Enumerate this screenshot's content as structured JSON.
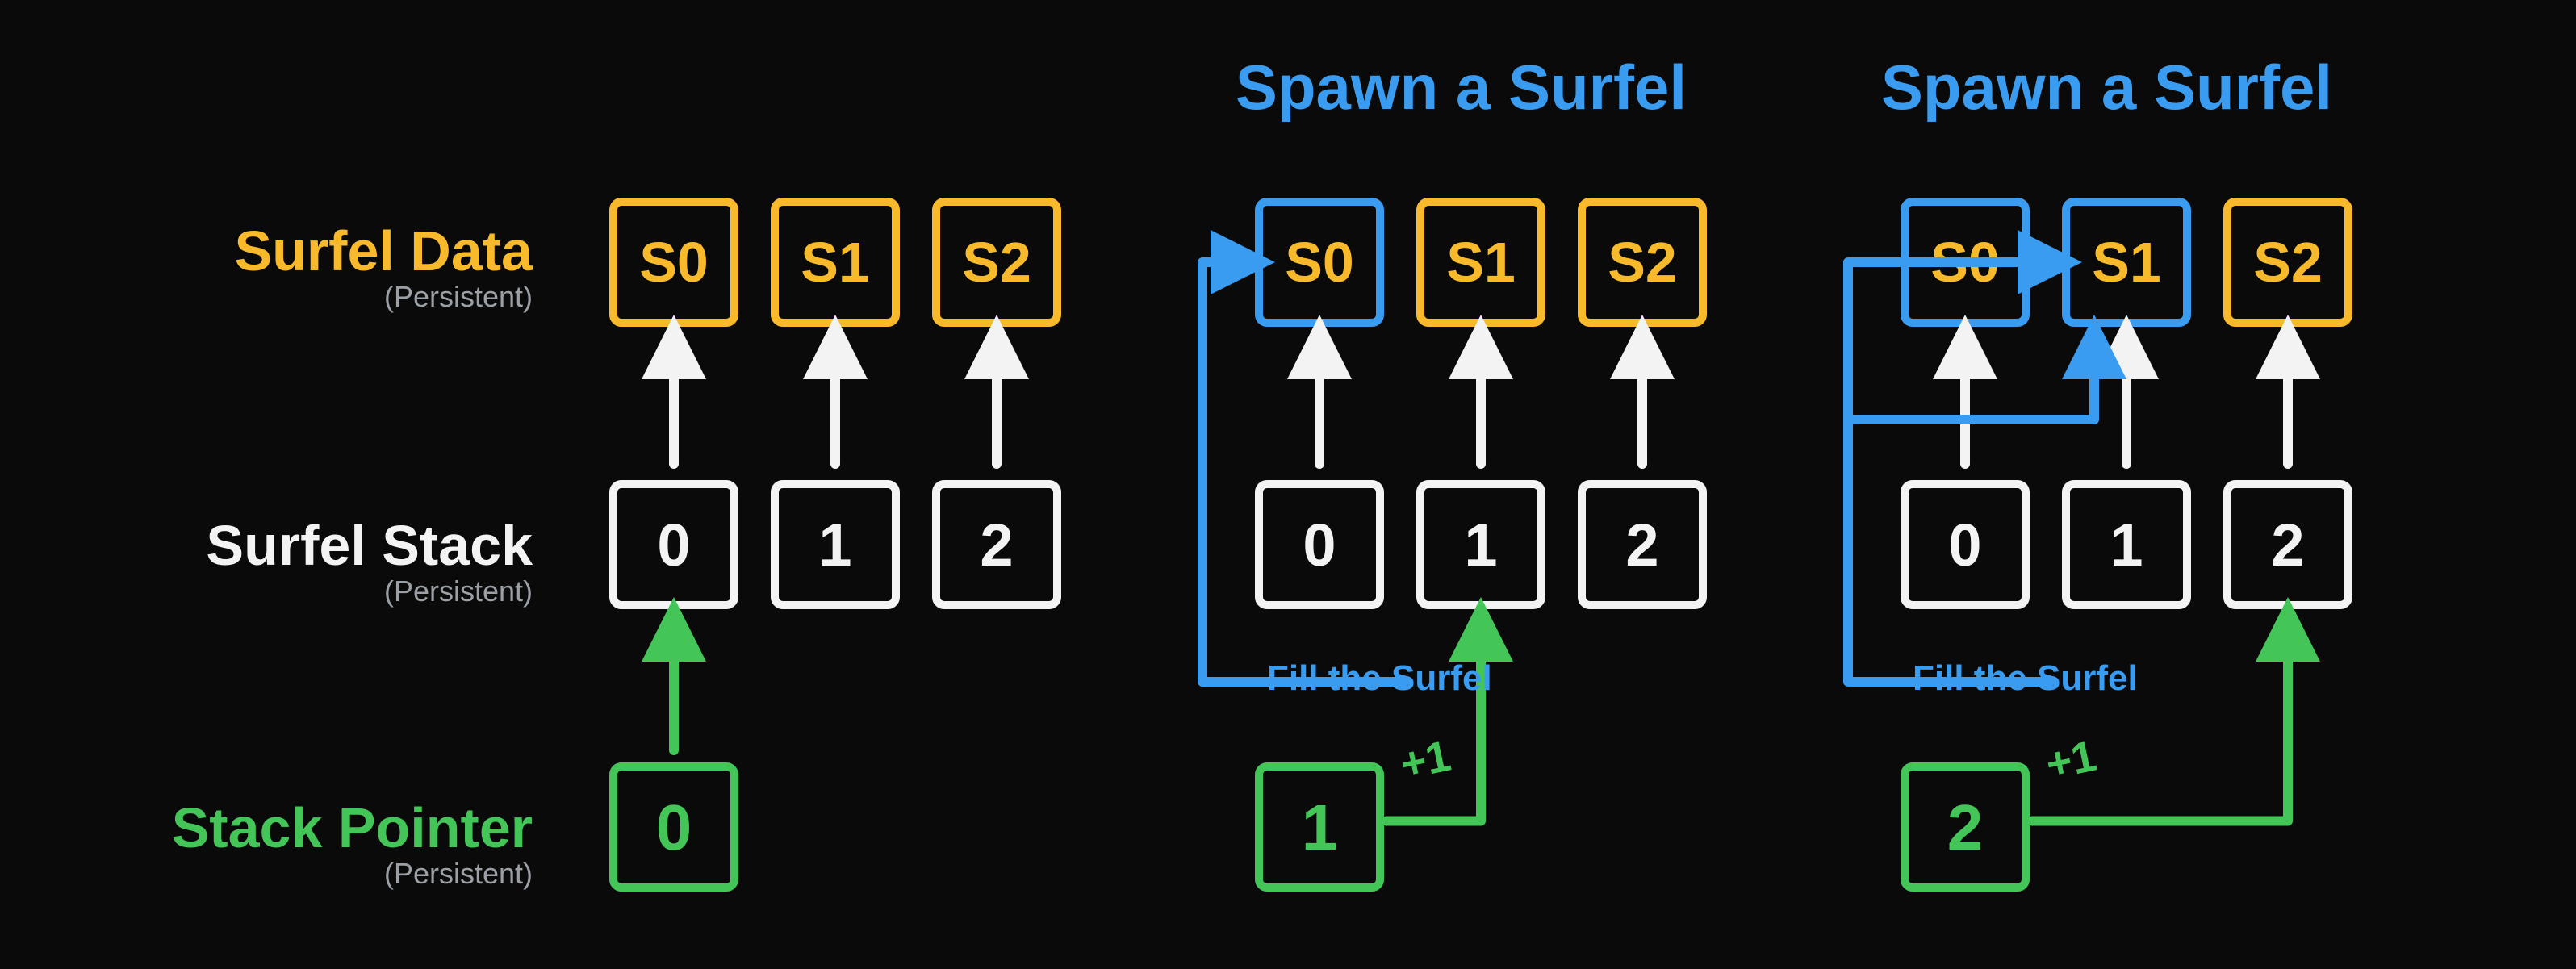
{
  "labels": {
    "surfel_data": "Surfel Data",
    "surfel_stack": "Surfel Stack",
    "stack_pointer": "Stack Pointer",
    "persistent": "(Persistent)"
  },
  "annotations": {
    "spawn": "Spawn a Surfel",
    "fill": "Fill the Surfel",
    "plus_one": "+1"
  },
  "data_cells": [
    "S0",
    "S1",
    "S2"
  ],
  "stack_cells": [
    "0",
    "1",
    "2"
  ],
  "frames": [
    {
      "pointer": "0",
      "spawn": false,
      "filled": []
    },
    {
      "pointer": "1",
      "spawn": true,
      "filled": [
        0
      ]
    },
    {
      "pointer": "2",
      "spawn": true,
      "filled": [
        0,
        1
      ]
    }
  ]
}
